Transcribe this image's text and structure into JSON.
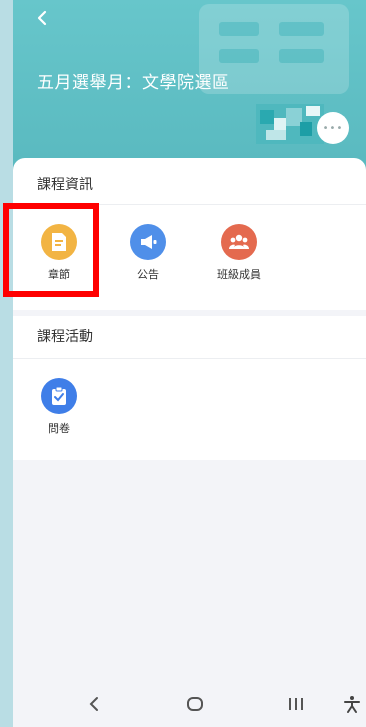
{
  "header": {
    "title": "五月選舉月：文學院選區",
    "more_label": "•••"
  },
  "course_info": {
    "title": "課程資訊",
    "items": [
      {
        "label": "章節",
        "icon": "document-icon",
        "color": "#f2b443"
      },
      {
        "label": "公告",
        "icon": "megaphone-icon",
        "color": "#4f8fe9"
      },
      {
        "label": "班級成員",
        "icon": "group-icon",
        "color": "#e46a4f"
      }
    ]
  },
  "course_activity": {
    "title": "課程活動",
    "items": [
      {
        "label": "問卷",
        "icon": "clipboard-check-icon",
        "color": "#3f7ee8"
      }
    ]
  },
  "colors": {
    "header_bg": "#5fbec4",
    "highlight": "#ff0000"
  }
}
